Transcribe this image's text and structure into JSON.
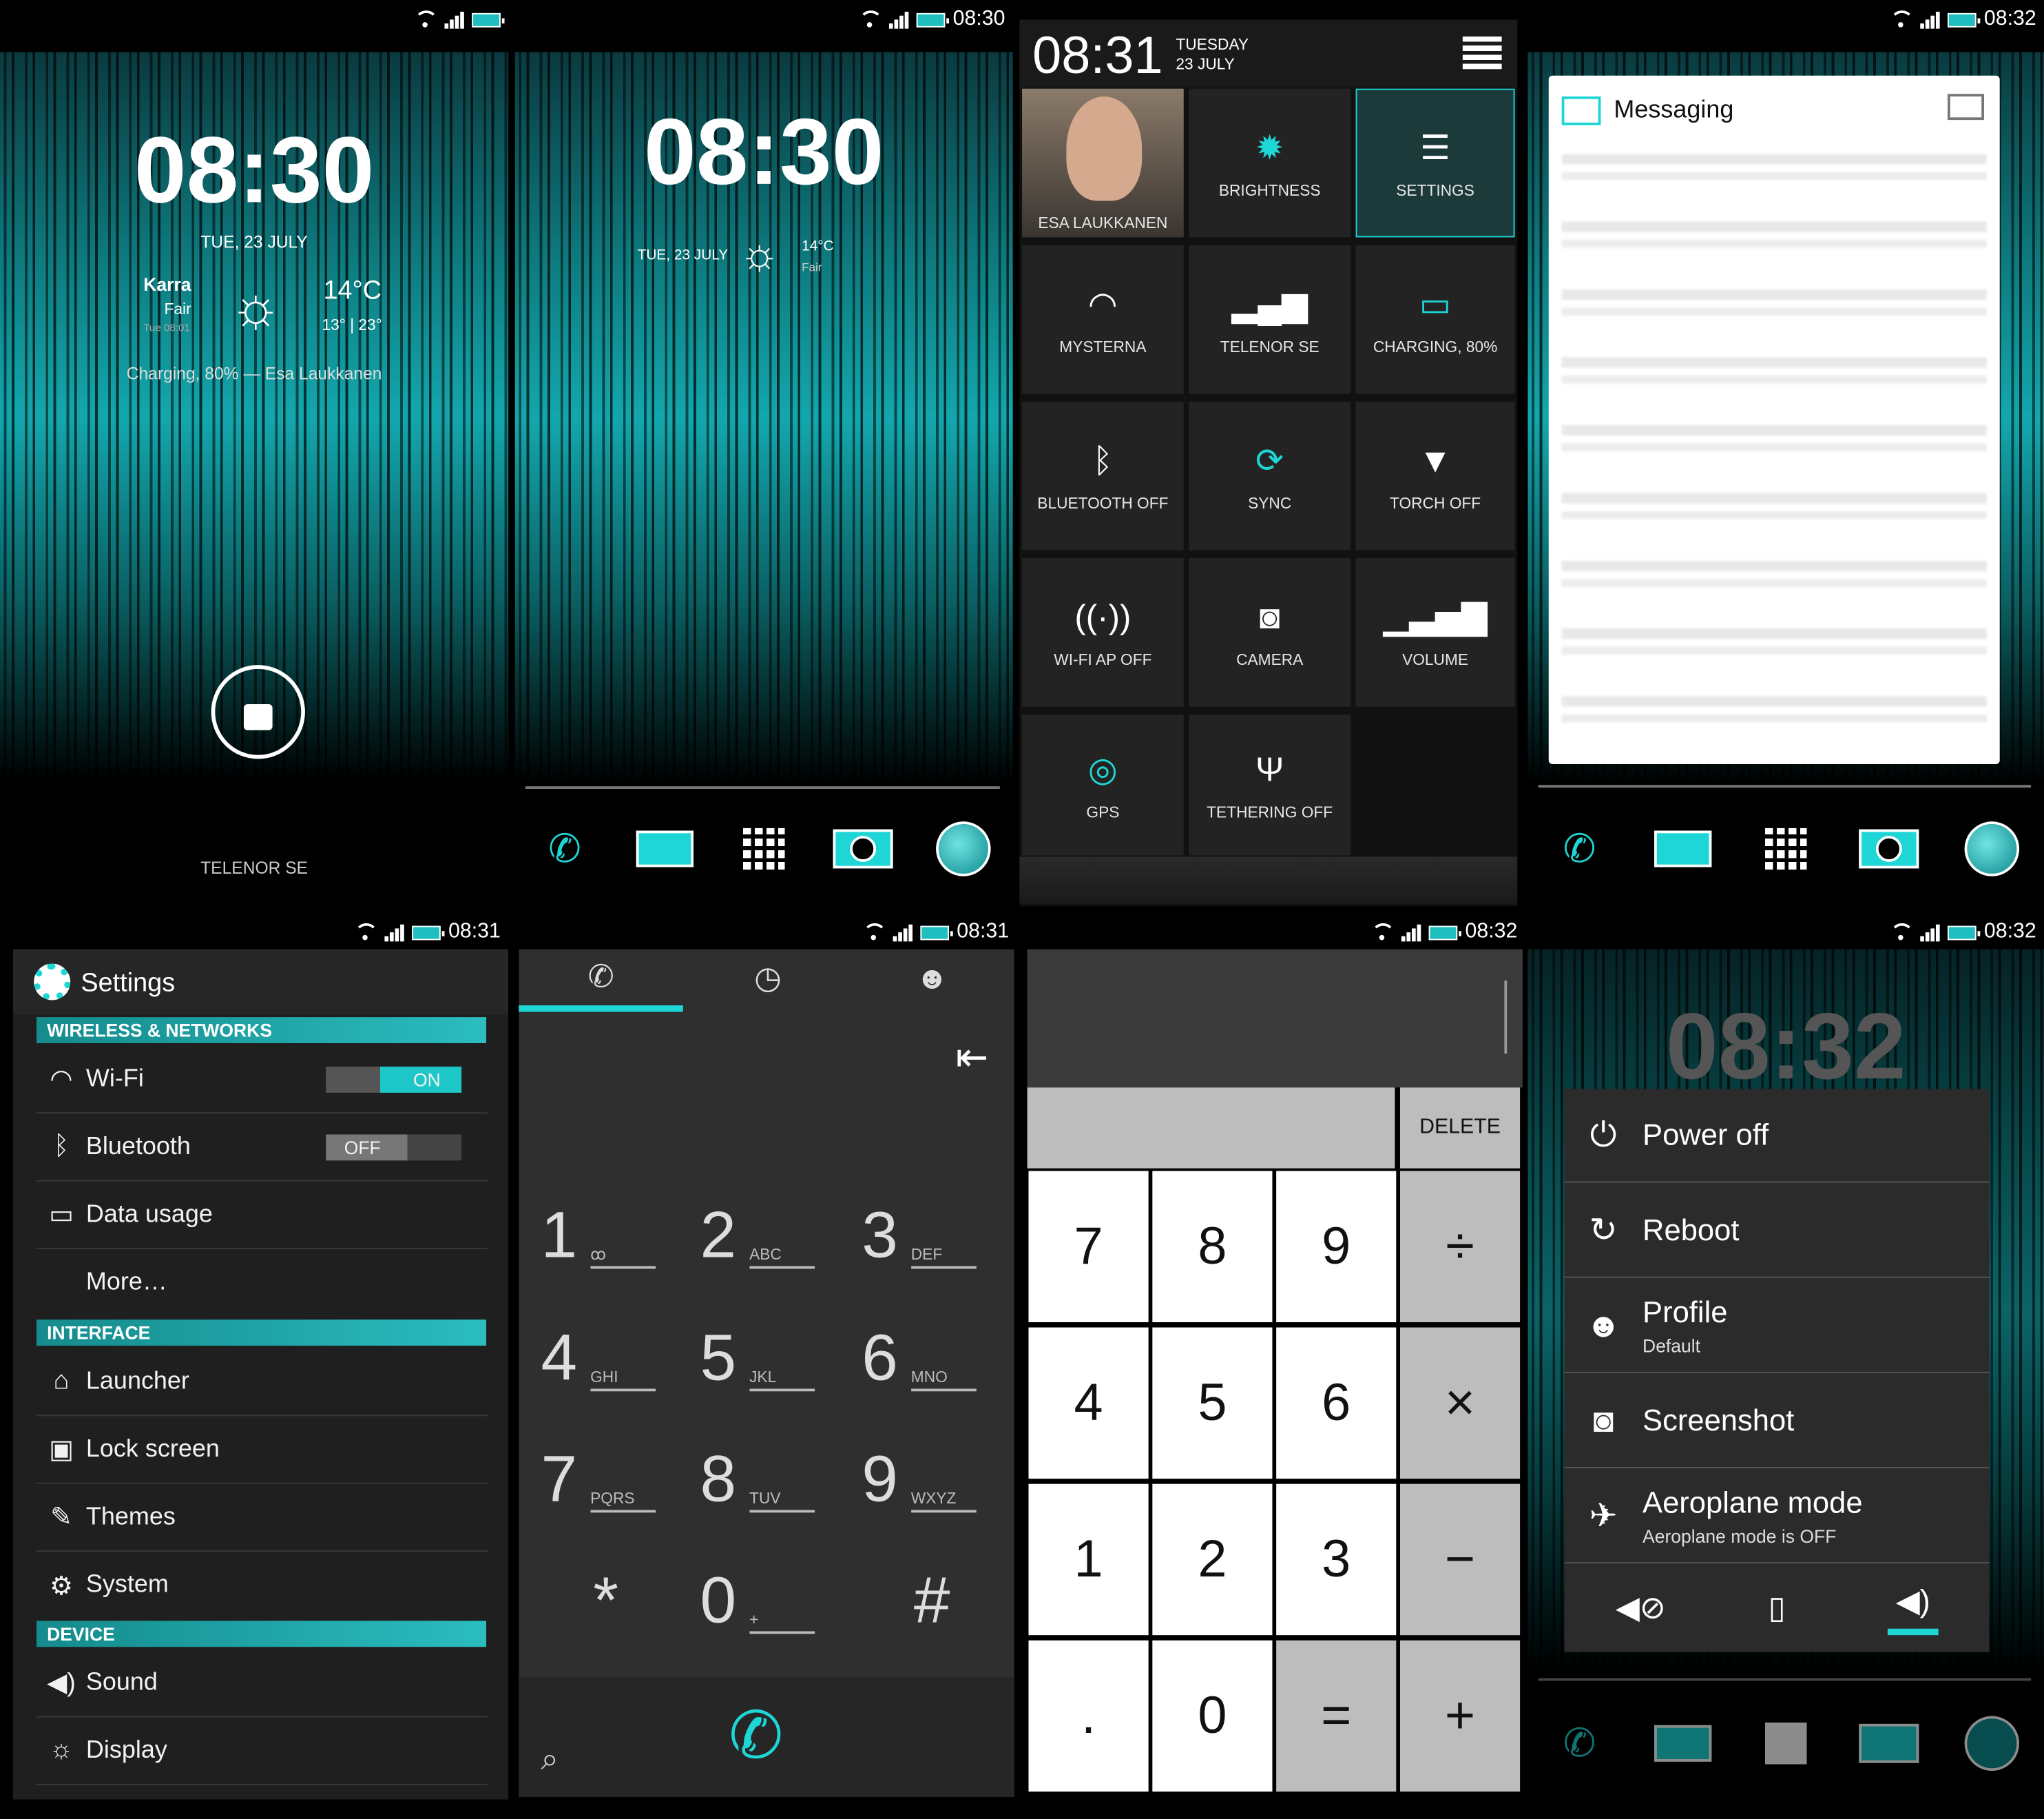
{
  "panel1": {
    "clock": "08:30",
    "date": "TUE, 23 JULY",
    "city": "Karra",
    "condition": "Fair",
    "updated": "Tue 08:01",
    "temp": "14°C",
    "range": "13° | 23°",
    "owner": "Charging, 80% — Esa Laukkanen",
    "carrier": "TELENOR SE"
  },
  "panel2": {
    "time": "08:30",
    "clock": "08:30",
    "date": "TUE, 23 JULY",
    "temp": "14°C",
    "condition": "Fair"
  },
  "panel3": {
    "time": "08:31",
    "day": "TUESDAY",
    "date": "23 JULY",
    "tiles": [
      "ESA LAUKKANEN",
      "BRIGHTNESS",
      "SETTINGS",
      "MYSTERNA",
      "TELENOR SE",
      "CHARGING, 80%",
      "BLUETOOTH OFF",
      "SYNC",
      "TORCH OFF",
      "WI-FI AP OFF",
      "CAMERA",
      "VOLUME",
      "GPS",
      "TETHERING OFF"
    ]
  },
  "panel4": {
    "time": "08:32",
    "title": "Messaging"
  },
  "panel5": {
    "time": "08:31",
    "title": "Settings",
    "h1": "WIRELESS & NETWORKS",
    "wifi": "Wi-Fi",
    "wifi_state": "ON",
    "bt": "Bluetooth",
    "bt_state": "OFF",
    "data": "Data usage",
    "more": "More…",
    "h2": "INTERFACE",
    "launcher": "Launcher",
    "lock": "Lock screen",
    "themes": "Themes",
    "system": "System",
    "h3": "DEVICE",
    "sound": "Sound",
    "display": "Display"
  },
  "panel6": {
    "time": "08:31",
    "keys": [
      [
        "1",
        "ꝏ"
      ],
      [
        "2",
        "ABC"
      ],
      [
        "3",
        "DEF"
      ],
      [
        "4",
        "GHI"
      ],
      [
        "5",
        "JKL"
      ],
      [
        "6",
        "MNO"
      ],
      [
        "7",
        "PQRS"
      ],
      [
        "8",
        "TUV"
      ],
      [
        "9",
        "WXYZ"
      ],
      [
        "*",
        ""
      ],
      [
        "0",
        "+"
      ],
      [
        "#",
        ""
      ]
    ]
  },
  "panel7": {
    "time": "08:32",
    "delete": "DELETE",
    "keys": [
      "7",
      "8",
      "9",
      "÷",
      "4",
      "5",
      "6",
      "×",
      "1",
      "2",
      "3",
      "−",
      ".",
      "0",
      "=",
      "+"
    ]
  },
  "panel8": {
    "time": "08:32",
    "clock": "08:32",
    "power": "Power off",
    "reboot": "Reboot",
    "profile": "Profile",
    "profile_sub": "Default",
    "screenshot": "Screenshot",
    "aeroplane": "Aeroplane mode",
    "aeroplane_sub": "Aeroplane mode is OFF"
  },
  "colors": {
    "accent": "#1ed6d6",
    "tile": "#232323",
    "panel": "#2b2b2b"
  }
}
